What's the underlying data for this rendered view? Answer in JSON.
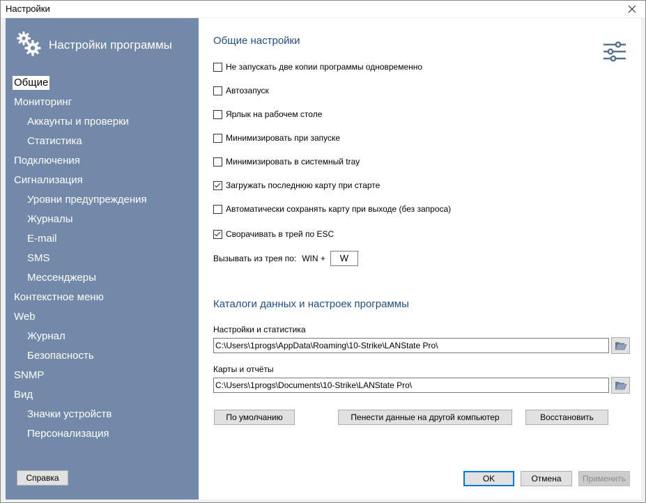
{
  "window": {
    "title": "Настройки"
  },
  "sidebar": {
    "app_title": "Настройки программы",
    "items": [
      {
        "label": "Общие",
        "level": 0,
        "active": true
      },
      {
        "label": "Мониторинг",
        "level": 0
      },
      {
        "label": "Аккаунты и проверки",
        "level": 1
      },
      {
        "label": "Статистика",
        "level": 1
      },
      {
        "label": "Подключения",
        "level": 0
      },
      {
        "label": "Сигнализация",
        "level": 0
      },
      {
        "label": "Уровни предупреждения",
        "level": 1
      },
      {
        "label": "Журналы",
        "level": 1
      },
      {
        "label": "E-mail",
        "level": 1
      },
      {
        "label": "SMS",
        "level": 1
      },
      {
        "label": "Мессенджеры",
        "level": 1
      },
      {
        "label": "Контекстное меню",
        "level": 0
      },
      {
        "label": "Web",
        "level": 0
      },
      {
        "label": "Журнал",
        "level": 1
      },
      {
        "label": "Безопасность",
        "level": 1
      },
      {
        "label": "SNMP",
        "level": 0
      },
      {
        "label": "Вид",
        "level": 0
      },
      {
        "label": "Значки устройств",
        "level": 1
      },
      {
        "label": "Персонализация",
        "level": 1
      }
    ],
    "help_label": "Справка"
  },
  "general": {
    "title": "Общие настройки",
    "options": [
      {
        "label": "Не запускать две копии программы одновременно",
        "checked": false
      },
      {
        "label": "Автозапуск",
        "checked": false
      },
      {
        "label": "Ярлык на рабочем столе",
        "checked": false
      },
      {
        "label": "Минимизировать при запуске",
        "checked": false
      },
      {
        "label": "Минимизировать в системный tray",
        "checked": false
      },
      {
        "label": "Загружать последнюю  карту при старте",
        "checked": true
      },
      {
        "label": "Автоматически сохранять карту при выходе (без запроса)",
        "checked": false
      },
      {
        "label": "Сворачивать в трей по ESC",
        "checked": true
      }
    ],
    "hotkey": {
      "label": "Вызывать из трея по:",
      "modifier": "WIN +",
      "key": "W"
    }
  },
  "catalogs": {
    "title": "Каталоги данных и настроек программы",
    "settings_label": "Настройки и статистика",
    "settings_path": "C:\\Users\\1progs\\AppData\\Roaming\\10-Strike\\LANState Pro\\",
    "maps_label": "Карты и отчёты",
    "maps_path": "C:\\Users\\1progs\\Documents\\10-Strike\\LANState Pro\\"
  },
  "actions": {
    "default_label": "По умолчанию",
    "transfer_label": "Пенести данные на другой компьютер",
    "restore_label": "Восстановить"
  },
  "footer": {
    "ok_label": "OK",
    "cancel_label": "Отмена",
    "apply_label": "Применить"
  }
}
